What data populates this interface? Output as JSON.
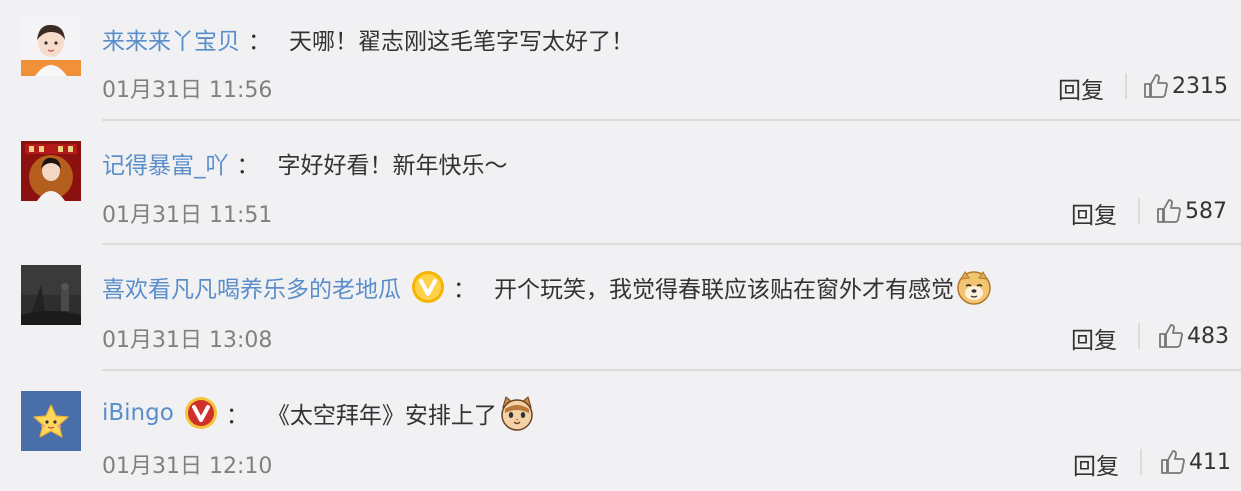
{
  "comments": [
    {
      "username": "来来来丫宝贝",
      "colon": "：",
      "text": "天哪！翟志刚这毛笔字写太好了！",
      "time": "01月31日 11:56",
      "reply_label": "回复",
      "likes": "2315",
      "verified": false,
      "emoji": ""
    },
    {
      "username": "记得暴富_吖",
      "colon": "：",
      "text": "字好好看！新年快乐～",
      "time": "01月31日 11:51",
      "reply_label": "回复",
      "likes": "587",
      "verified": false,
      "emoji": ""
    },
    {
      "username": "喜欢看凡凡喝养乐多的老地瓜",
      "colon": "：",
      "text": "开个玩笑，我觉得春联应该贴在窗外才有感觉",
      "time": "01月31日 13:08",
      "reply_label": "回复",
      "likes": "483",
      "verified": true,
      "verified_color": "#f5b400",
      "emoji": "doge-emoji"
    },
    {
      "username": "iBingo",
      "colon": "：",
      "text": "《太空拜年》安排上了",
      "time": "01月31日 12:10",
      "reply_label": "回复",
      "likes": "411",
      "verified": true,
      "verified_color": "#d0302a",
      "emoji": "cat-emoji"
    }
  ],
  "colors": {
    "background": "#f1f1f4",
    "username": "#5a8ec9",
    "text": "#333333",
    "time": "#808080",
    "divider": "#dcdcdc"
  }
}
